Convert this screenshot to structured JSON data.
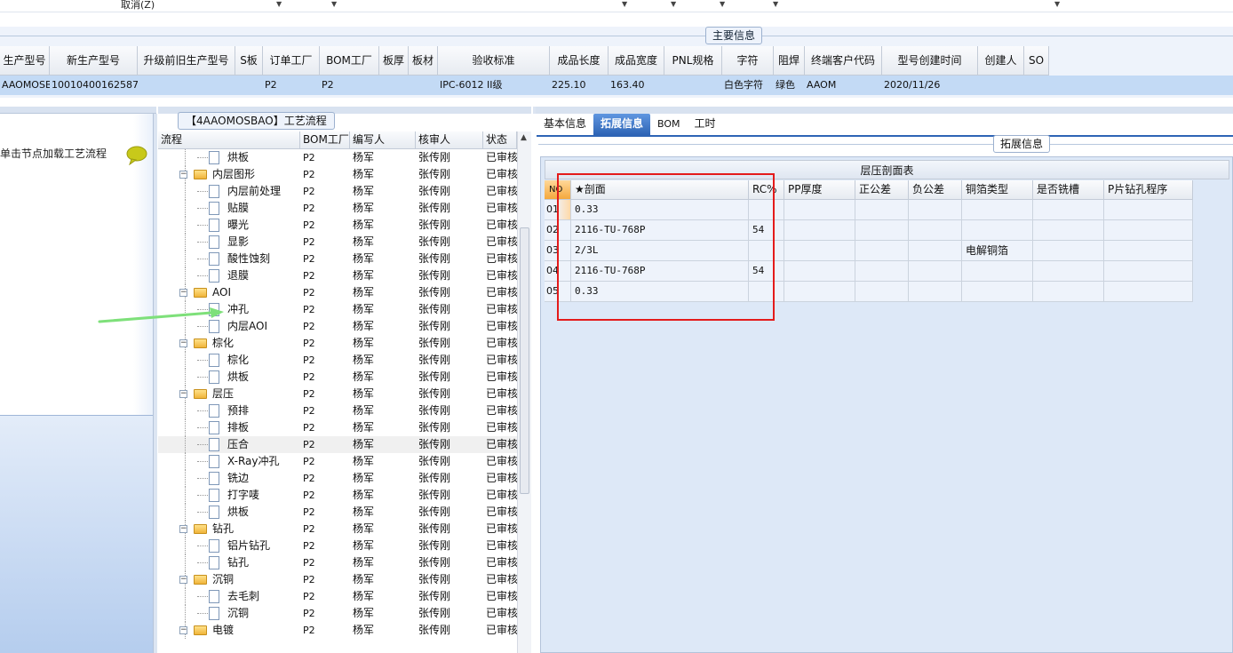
{
  "topbar": {
    "cancel_label": "取消(Z)"
  },
  "main_info": {
    "group_title": "主要信息",
    "columns": [
      "生产型号",
      "新生产型号",
      "升级前旧生产型号",
      "S板",
      "订单工厂",
      "BOM工厂",
      "板厚",
      "板材",
      "验收标准",
      "成品长度",
      "成品宽度",
      "PNL规格",
      "字符",
      "阻焊",
      "终端客户代码",
      "型号创建时间",
      "创建人",
      "SO"
    ],
    "row": [
      "AAOMOSBAO",
      "10010400162587",
      "",
      "",
      "P2",
      "P2",
      "",
      "",
      "IPC-6012 II级",
      "225.10",
      "163.40",
      "",
      "白色字符",
      "绿色",
      "AAOM",
      "2020/11/26",
      "",
      ""
    ]
  },
  "left_panel": {
    "hint": "单击节点加载工艺流程"
  },
  "process_panel": {
    "title": "【4AAOMOSBAO】工艺流程",
    "columns": [
      "流程",
      "BOM工厂",
      "编写人",
      "核审人",
      "状态"
    ],
    "rows": [
      {
        "name": "烘板",
        "bom": "P2",
        "writer": "杨军",
        "reviewer": "张传刚",
        "status": "已审核",
        "type": "step"
      },
      {
        "name": "内层图形",
        "bom": "P2",
        "writer": "杨军",
        "reviewer": "张传刚",
        "status": "已审核",
        "type": "group"
      },
      {
        "name": "内层前处理",
        "bom": "P2",
        "writer": "杨军",
        "reviewer": "张传刚",
        "status": "已审核",
        "type": "step"
      },
      {
        "name": "贴膜",
        "bom": "P2",
        "writer": "杨军",
        "reviewer": "张传刚",
        "status": "已审核",
        "type": "step"
      },
      {
        "name": "曝光",
        "bom": "P2",
        "writer": "杨军",
        "reviewer": "张传刚",
        "status": "已审核",
        "type": "step"
      },
      {
        "name": "显影",
        "bom": "P2",
        "writer": "杨军",
        "reviewer": "张传刚",
        "status": "已审核",
        "type": "step"
      },
      {
        "name": "酸性蚀刻",
        "bom": "P2",
        "writer": "杨军",
        "reviewer": "张传刚",
        "status": "已审核",
        "type": "step"
      },
      {
        "name": "退膜",
        "bom": "P2",
        "writer": "杨军",
        "reviewer": "张传刚",
        "status": "已审核",
        "type": "step"
      },
      {
        "name": "AOI",
        "bom": "P2",
        "writer": "杨军",
        "reviewer": "张传刚",
        "status": "已审核",
        "type": "group"
      },
      {
        "name": "冲孔",
        "bom": "P2",
        "writer": "杨军",
        "reviewer": "张传刚",
        "status": "已审核",
        "type": "step"
      },
      {
        "name": "内层AOI",
        "bom": "P2",
        "writer": "杨军",
        "reviewer": "张传刚",
        "status": "已审核",
        "type": "step"
      },
      {
        "name": "棕化",
        "bom": "P2",
        "writer": "杨军",
        "reviewer": "张传刚",
        "status": "已审核",
        "type": "group"
      },
      {
        "name": "棕化",
        "bom": "P2",
        "writer": "杨军",
        "reviewer": "张传刚",
        "status": "已审核",
        "type": "step"
      },
      {
        "name": "烘板",
        "bom": "P2",
        "writer": "杨军",
        "reviewer": "张传刚",
        "status": "已审核",
        "type": "step"
      },
      {
        "name": "层压",
        "bom": "P2",
        "writer": "杨军",
        "reviewer": "张传刚",
        "status": "已审核",
        "type": "group"
      },
      {
        "name": "预排",
        "bom": "P2",
        "writer": "杨军",
        "reviewer": "张传刚",
        "status": "已审核",
        "type": "step"
      },
      {
        "name": "排板",
        "bom": "P2",
        "writer": "杨军",
        "reviewer": "张传刚",
        "status": "已审核",
        "type": "step"
      },
      {
        "name": "压合",
        "bom": "P2",
        "writer": "杨军",
        "reviewer": "张传刚",
        "status": "已审核",
        "type": "step",
        "selected": true
      },
      {
        "name": "X-Ray冲孔",
        "bom": "P2",
        "writer": "杨军",
        "reviewer": "张传刚",
        "status": "已审核",
        "type": "step"
      },
      {
        "name": "铣边",
        "bom": "P2",
        "writer": "杨军",
        "reviewer": "张传刚",
        "status": "已审核",
        "type": "step"
      },
      {
        "name": "打字唛",
        "bom": "P2",
        "writer": "杨军",
        "reviewer": "张传刚",
        "status": "已审核",
        "type": "step"
      },
      {
        "name": "烘板",
        "bom": "P2",
        "writer": "杨军",
        "reviewer": "张传刚",
        "status": "已审核",
        "type": "step"
      },
      {
        "name": "钻孔",
        "bom": "P2",
        "writer": "杨军",
        "reviewer": "张传刚",
        "status": "已审核",
        "type": "group"
      },
      {
        "name": "铝片钻孔",
        "bom": "P2",
        "writer": "杨军",
        "reviewer": "张传刚",
        "status": "已审核",
        "type": "step"
      },
      {
        "name": "钻孔",
        "bom": "P2",
        "writer": "杨军",
        "reviewer": "张传刚",
        "status": "已审核",
        "type": "step"
      },
      {
        "name": "沉铜",
        "bom": "P2",
        "writer": "杨军",
        "reviewer": "张传刚",
        "status": "已审核",
        "type": "group"
      },
      {
        "name": "去毛刺",
        "bom": "P2",
        "writer": "杨军",
        "reviewer": "张传刚",
        "status": "已审核",
        "type": "step"
      },
      {
        "name": "沉铜",
        "bom": "P2",
        "writer": "杨军",
        "reviewer": "张传刚",
        "status": "已审核",
        "type": "step"
      },
      {
        "name": "电镀",
        "bom": "P2",
        "writer": "杨军",
        "reviewer": "张传刚",
        "status": "已审核",
        "type": "group"
      }
    ]
  },
  "right_panel": {
    "tabs": [
      "基本信息",
      "拓展信息",
      "BOM",
      "工时"
    ],
    "active_tab": "拓展信息",
    "group_title": "拓展信息",
    "laminate_title": "层压剖面表",
    "laminate_columns": [
      "NO",
      "★剖面",
      "RC%",
      "PP厚度",
      "正公差",
      "负公差",
      "铜箔类型",
      "是否铣槽",
      "P片钻孔程序"
    ],
    "laminate_rows": [
      [
        "01",
        "0.33",
        "",
        "",
        "",
        "",
        "",
        "",
        ""
      ],
      [
        "02",
        "2116-TU-768P",
        "54",
        "",
        "",
        "",
        "",
        "",
        ""
      ],
      [
        "03",
        "2/3L",
        "",
        "",
        "",
        "",
        "电解铜箔",
        "",
        ""
      ],
      [
        "04",
        "2116-TU-768P",
        "54",
        "",
        "",
        "",
        "",
        "",
        ""
      ],
      [
        "05",
        "0.33",
        "",
        "",
        "",
        "",
        "",
        "",
        ""
      ]
    ]
  },
  "colors": {
    "selected_row": "#c3daf5",
    "active_tab": "#2e64b5",
    "highlight_box": "#e41b1b",
    "arrow": "#7ee07a"
  }
}
